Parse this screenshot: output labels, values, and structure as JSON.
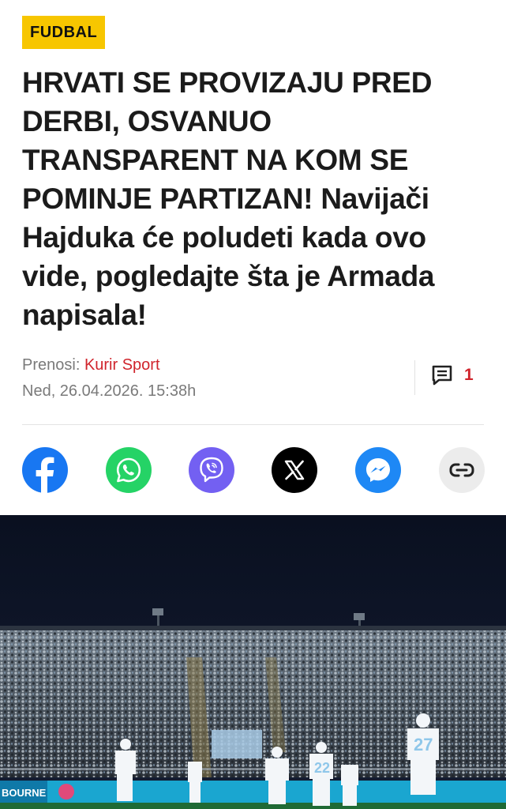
{
  "category": "FUDBAL",
  "headline": "HRVATI SE PROVIZAJU PRED DERBI, OSVANUO TRANSPARENT NA KOM SE POMINJE PARTIZAN! Navijači Hajduka će poludeti kada ovo vide, pogledajte šta je Armada napisala!",
  "meta": {
    "source_label": "Prenosi:",
    "source_name": "Kurir Sport",
    "date": "Ned, 26.04.2026. 15:38h"
  },
  "comments": {
    "icon": "comment-icon",
    "count": "1"
  },
  "share": [
    {
      "name": "facebook",
      "icon": "facebook-icon",
      "color": "#1877f2"
    },
    {
      "name": "whatsapp",
      "icon": "whatsapp-icon",
      "color": "#25d366"
    },
    {
      "name": "viber",
      "icon": "viber-icon",
      "color": "#7360f2"
    },
    {
      "name": "x",
      "icon": "x-icon",
      "color": "#000000"
    },
    {
      "name": "messenger",
      "icon": "messenger-icon",
      "color": "#1e88f5"
    },
    {
      "name": "copy-link",
      "icon": "link-icon",
      "color": "#ececec"
    }
  ],
  "hero_image": {
    "board_text_left": "BOURNE",
    "player_numbers": [
      "22",
      "27"
    ]
  },
  "colors": {
    "accent_red": "#d0242c",
    "badge_yellow": "#f7c600"
  }
}
